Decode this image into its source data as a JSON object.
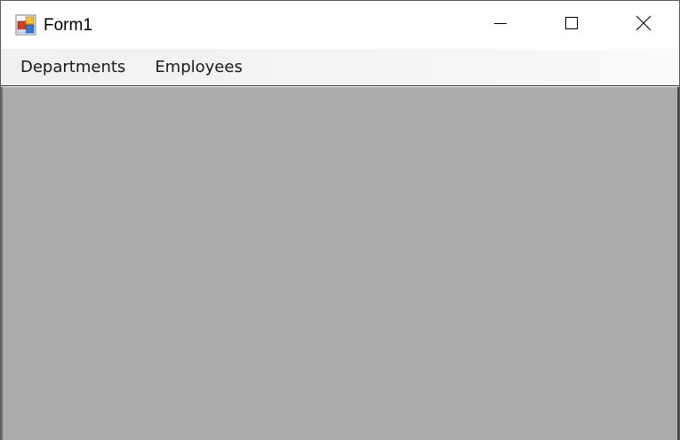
{
  "window": {
    "title": "Form1"
  },
  "title_bar": {
    "icon": "winforms-app-icon",
    "buttons": [
      {
        "name": "minimize",
        "icon": "minimize-icon"
      },
      {
        "name": "maximize",
        "icon": "maximize-icon"
      },
      {
        "name": "close",
        "icon": "close-icon"
      }
    ]
  },
  "menu": {
    "items": [
      {
        "label": "Departments"
      },
      {
        "label": "Employees"
      }
    ]
  },
  "colors": {
    "client_area": "#ababab",
    "title_bar": "#ffffff",
    "menu_bar": "#f0f0f0"
  }
}
